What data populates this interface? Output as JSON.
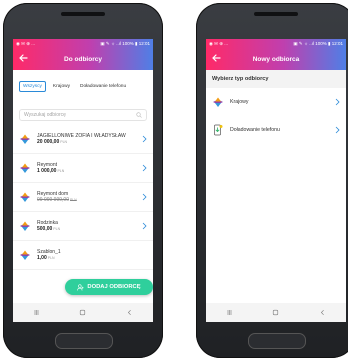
{
  "left_phone": {
    "status": {
      "left": "◉ ✉ ⊕ ...",
      "right": "▣ ✎ ☼ ..ıl 100% ▮ 12:01"
    },
    "appbar": {
      "title": "Do odbiorcy"
    },
    "tabs": [
      {
        "label": "Wszyscy",
        "active": true
      },
      {
        "label": "Krajowy",
        "active": false
      },
      {
        "label": "Doładowanie telefonu",
        "active": false
      }
    ],
    "search": {
      "placeholder": "Wyszukaj odbiorcę"
    },
    "recipients": [
      {
        "name": "JAGIELLONIWE ZOFIA I WŁADYSŁAW",
        "amount": "20 000,00",
        "currency": "PLN",
        "strike": false
      },
      {
        "name": "Reymont",
        "amount": "1 000,00",
        "currency": "PLN",
        "strike": false
      },
      {
        "name": "Reymont dom",
        "amount": "99 999 999,00",
        "currency": "PLN",
        "strike": true
      },
      {
        "name": "Rodzinka",
        "amount": "500,00",
        "currency": "PLN",
        "strike": false
      },
      {
        "name": "Szablon_1",
        "amount": "1,00",
        "currency": "PLN",
        "strike": false
      }
    ],
    "fab": {
      "label": "DODAJ ODBIORCĘ"
    }
  },
  "right_phone": {
    "status": {
      "left": "◉ ✉ ⊕ ...",
      "right": "▣ ✎ ☼ ..ıl 100% ▮ 12:01"
    },
    "appbar": {
      "title": "Nowy odbiorca"
    },
    "section_title": "Wybierz typ odbiorcy",
    "types": [
      {
        "label": "Krajowy",
        "icon": "transfer-icon"
      },
      {
        "label": "Doładowanie telefonu",
        "icon": "phone-topup-icon"
      }
    ]
  },
  "colors": {
    "gradient_start": "#ff2a68",
    "gradient_mid": "#c03fae",
    "gradient_end": "#4f7fe6",
    "accent_blue": "#2a8ad8",
    "fab_green": "#2fcf9c"
  }
}
